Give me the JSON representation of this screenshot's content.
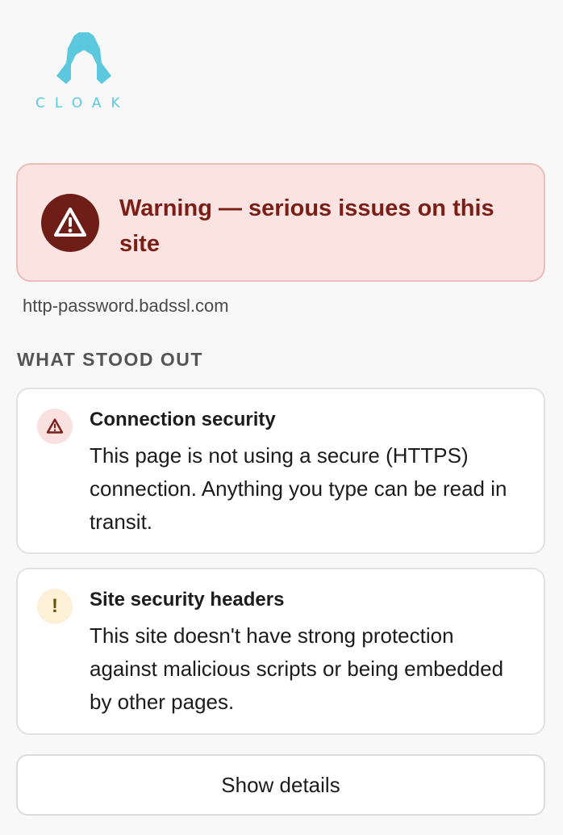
{
  "brand": {
    "logo_text": "CLOAK",
    "logo_icon": "hooded-figure-icon",
    "color": "#5bc8dd"
  },
  "banner": {
    "icon": "warning-triangle-icon",
    "title": "Warning — serious issues on this site",
    "background": "#fae3e1",
    "accent": "#7a1f18"
  },
  "site": {
    "domain": "http-password.badssl.com"
  },
  "findings": {
    "heading": "WHAT STOOD OUT",
    "items": [
      {
        "icon": "warning-triangle-icon",
        "severity": "danger",
        "title": "Connection security",
        "description": "This page is not using a secure (HTTPS) connection. Anything you type can be read in transit."
      },
      {
        "icon": "exclamation-icon",
        "severity": "caution",
        "glyph": "!",
        "title": "Site security headers",
        "description": "This site doesn't have strong protection against malicious scripts or being embedded by other pages."
      }
    ]
  },
  "actions": {
    "show_details_label": "Show details"
  }
}
